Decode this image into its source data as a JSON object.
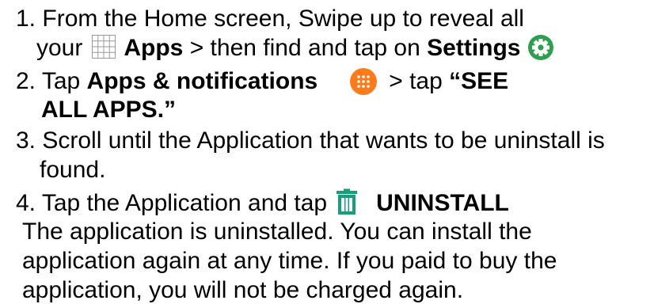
{
  "steps": {
    "s1": {
      "number": "1.",
      "line1": "From the Home screen, Swipe up to reveal all",
      "your": "your",
      "apps": "Apps",
      "then": "> then find and tap on",
      "settings": "Settings",
      "apps_icon": "apps-grid-icon",
      "settings_icon": "settings-gear-icon"
    },
    "s2": {
      "number": "2.",
      "tap": "Tap",
      "apps_notifications": "Apps & notifications",
      "tap2": "> tap",
      "see": "“SEE",
      "all_apps": "ALL APPS.”",
      "icon": "apps-notifications-icon"
    },
    "s3": {
      "number": "3.",
      "line1": "Scroll until the Application that wants to be uninstall is",
      "line2": "found."
    },
    "s4": {
      "number": "4.",
      "text": "Tap the Application and tap",
      "uninstall": "UNINSTALL",
      "icon": "trash-icon"
    }
  },
  "note": {
    "line1": "The application is uninstalled. You can install the",
    "line2": "application again at any time. If you paid to buy the",
    "line3": "application, you will not be charged again."
  },
  "colors": {
    "settings_green": "#2e9e4f",
    "notif_orange": "#ff7a18",
    "trash_green": "#16a07a",
    "grid_gray": "#9a9a9a"
  }
}
